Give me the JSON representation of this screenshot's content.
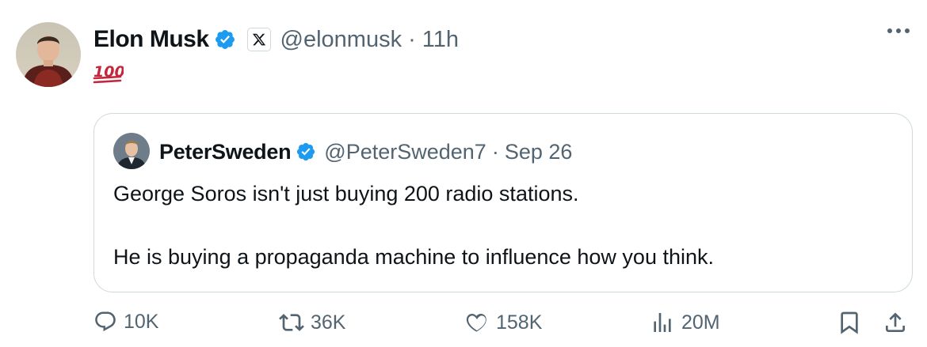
{
  "tweet": {
    "author_name": "Elon Musk",
    "handle": "@elonmusk",
    "separator": "·",
    "time": "11h",
    "emoji_text": "💯"
  },
  "quoted": {
    "author_name": "PeterSweden",
    "handle": "@PeterSweden7",
    "separator": "·",
    "time": "Sep 26",
    "line1": "George Soros isn't just buying 200 radio stations.",
    "line2": "He is buying a propaganda machine to influence how you think."
  },
  "actions": {
    "replies": "10K",
    "reposts": "36K",
    "likes": "158K",
    "views": "20M"
  },
  "colors": {
    "verified": "#1d9bf0",
    "secondary_text": "#536471",
    "border": "#cfd9de",
    "hundred_red": "#c4273b"
  },
  "icons": [
    "more-icon",
    "verified-badge-icon",
    "x-logo-icon",
    "reply-icon",
    "repost-icon",
    "like-icon",
    "views-icon",
    "bookmark-icon",
    "share-icon"
  ]
}
